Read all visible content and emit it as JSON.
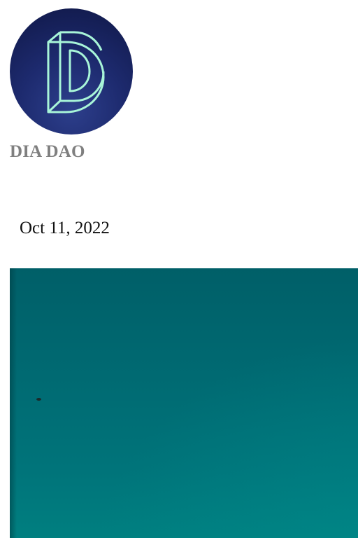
{
  "publication": {
    "name": "DIA DAO",
    "logo_icon": "dia-dao-logo-icon",
    "colors": {
      "logo_background": "#1d2a6e",
      "logo_mark": "#a8f5d8",
      "name_text": "#7f7f7f"
    }
  },
  "post": {
    "date": "Oct 11, 2022",
    "cover_image_color": "#006a72"
  }
}
